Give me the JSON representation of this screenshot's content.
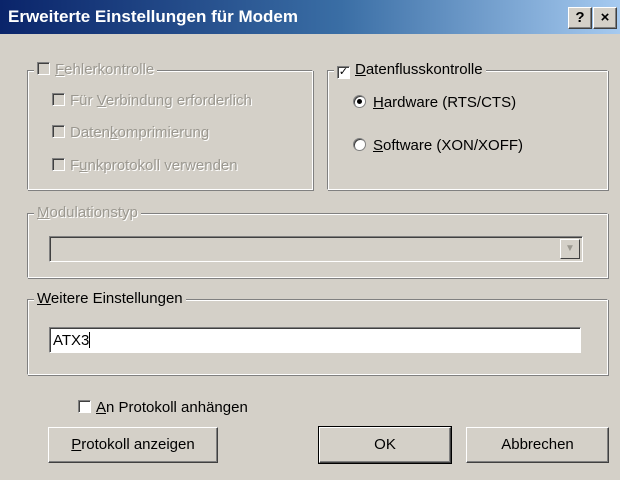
{
  "window": {
    "title": "Erweiterte Einstellungen für Modem",
    "help_label": "?",
    "close_label": "×"
  },
  "error_control": {
    "label_pre": "",
    "label_ul": "F",
    "label_post": "ehlerkontrolle",
    "enabled": false,
    "options": [
      {
        "pre": "Für ",
        "ul": "V",
        "post": "erbindung erforderlich"
      },
      {
        "pre": "Daten",
        "ul": "k",
        "post": "omprimierung"
      },
      {
        "pre": "F",
        "ul": "u",
        "post": "nkprotokoll verwenden"
      }
    ]
  },
  "flow_control": {
    "label_pre": "",
    "label_ul": "D",
    "label_post": "atenflusskontrolle",
    "checked": true,
    "check_glyph": "✓",
    "options": [
      {
        "pre": "",
        "ul": "H",
        "post": "ardware (RTS/CTS)",
        "selected": true
      },
      {
        "pre": "",
        "ul": "S",
        "post": "oftware (XON/XOFF)",
        "selected": false
      }
    ]
  },
  "modulation": {
    "label_pre": "",
    "label_ul": "M",
    "label_post": "odulationstyp",
    "value": "",
    "enabled": false,
    "arrow_glyph": "▼"
  },
  "extra": {
    "label_pre": "",
    "label_ul": "W",
    "label_post": "eitere Einstellungen",
    "value": "ATX3"
  },
  "log_append": {
    "label_pre": "",
    "label_ul": "A",
    "label_post": "n Protokoll anhängen",
    "checked": false
  },
  "buttons": {
    "show_log": {
      "pre": "",
      "ul": "P",
      "post": "rotokoll anzeigen"
    },
    "ok": "OK",
    "cancel": "Abbrechen"
  },
  "colors": {
    "face": "#d4d0c8",
    "title_start": "#0a246a",
    "title_end": "#a6caf0",
    "disabled_text": "#9b9890"
  }
}
